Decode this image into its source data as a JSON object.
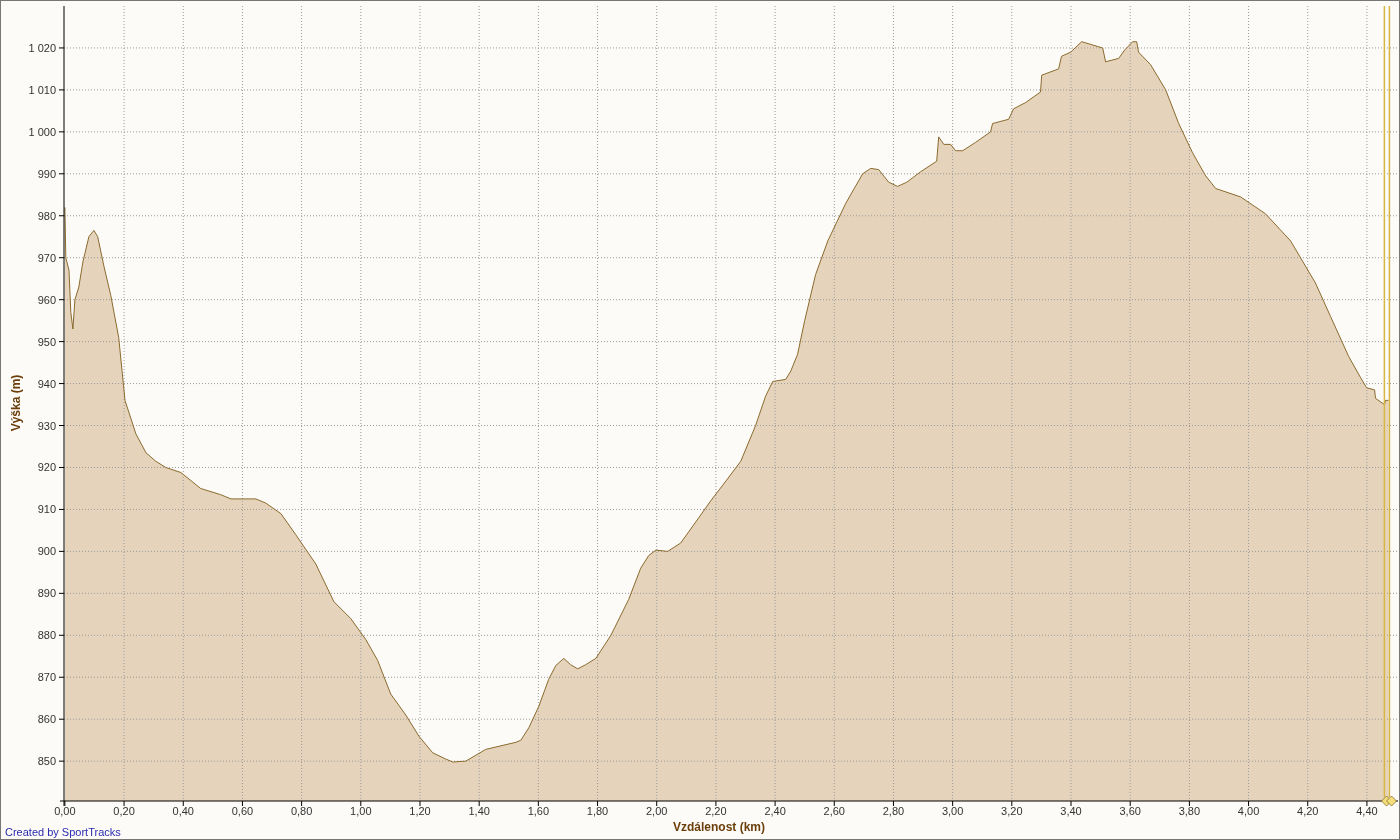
{
  "chart": {
    "chart_data": {
      "type": "area",
      "xlabel": "Vzdálenost (km)",
      "ylabel": "Výška (m)",
      "x": [
        0,
        0.003,
        0.014,
        0.02,
        0.027,
        0.034,
        0.047,
        0.061,
        0.081,
        0.098,
        0.111,
        0.132,
        0.155,
        0.182,
        0.203,
        0.24,
        0.274,
        0.307,
        0.341,
        0.392,
        0.459,
        0.527,
        0.561,
        0.645,
        0.679,
        0.73,
        0.78,
        0.848,
        0.909,
        0.966,
        1.017,
        1.057,
        1.101,
        1.152,
        1.196,
        1.243,
        1.287,
        1.311,
        1.355,
        1.422,
        1.524,
        1.541,
        1.568,
        1.601,
        1.635,
        1.659,
        1.686,
        1.709,
        1.733,
        1.76,
        1.794,
        1.845,
        1.905,
        1.946,
        1.973,
        1.997,
        2.037,
        2.081,
        2.142,
        2.182,
        2.236,
        2.284,
        2.334,
        2.368,
        2.392,
        2.436,
        2.453,
        2.476,
        2.5,
        2.537,
        2.578,
        2.639,
        2.696,
        2.723,
        2.75,
        2.784,
        2.814,
        2.845,
        2.892,
        2.946,
        2.953,
        2.97,
        2.993,
        3.01,
        3.034,
        3.078,
        3.128,
        3.135,
        3.189,
        3.206,
        3.247,
        3.297,
        3.301,
        3.358,
        3.368,
        3.399,
        3.436,
        3.507,
        3.517,
        3.561,
        3.581,
        3.608,
        3.622,
        3.628,
        3.669,
        3.72,
        3.764,
        3.811,
        3.855,
        3.889,
        3.973,
        4.057,
        4.142,
        4.226,
        4.277,
        4.338,
        4.378,
        4.399,
        4.426,
        4.429,
        4.459,
        4.463,
        4.473
      ],
      "series": [
        {
          "color": "#8b6a2e",
          "values": [
            982,
            970,
            967,
            957,
            953,
            960,
            963,
            969,
            975,
            976.5,
            975,
            968,
            961,
            951,
            936,
            928,
            923.5,
            921.5,
            920,
            918.8,
            915,
            913.5,
            912.5,
            912.5,
            911.5,
            909,
            904,
            897,
            888,
            884,
            879,
            874,
            866,
            861,
            856,
            852,
            850.5,
            849.8,
            850,
            852.8,
            854.5,
            855,
            858,
            863,
            869.5,
            872.8,
            874.5,
            873,
            872,
            873,
            874.5,
            880,
            888.5,
            896,
            899,
            900.3,
            900,
            902,
            908,
            912,
            917,
            921.5,
            930,
            937,
            940.5,
            941,
            943,
            947,
            955,
            966,
            974,
            983,
            990,
            991.3,
            991,
            988,
            987,
            988,
            990.5,
            993,
            998.8,
            997,
            997,
            995.5,
            995.5,
            997.5,
            1000,
            1002,
            1003,
            1005.5,
            1007,
            1009.5,
            1013.5,
            1015,
            1018,
            1019,
            1021.5,
            1020,
            1016.7,
            1017.5,
            1019.5,
            1021.5,
            1021.5,
            1019,
            1016,
            1010,
            1002,
            995,
            989.5,
            986.5,
            984.5,
            980.5,
            974,
            964,
            956,
            946.5,
            941.5,
            939,
            938.5,
            936.5,
            935,
            936,
            936
          ]
        }
      ],
      "grid": true,
      "ref_lines": [
        {
          "axis": "x",
          "value": 4.459,
          "color": "#d6b545"
        },
        {
          "axis": "x",
          "value": 4.476,
          "color": "#d6b545"
        }
      ],
      "xlim": [
        -0.003,
        4.505
      ],
      "ylim": [
        840.5,
        1030
      ],
      "xticks": [
        {
          "value": 0,
          "label": "0,00"
        },
        {
          "value": 0.2,
          "label": "0,20"
        },
        {
          "value": 0.4,
          "label": "0,40"
        },
        {
          "value": 0.6,
          "label": "0,60"
        },
        {
          "value": 0.8,
          "label": "0,80"
        },
        {
          "value": 1.0,
          "label": "1,00"
        },
        {
          "value": 1.2,
          "label": "1,20"
        },
        {
          "value": 1.4,
          "label": "1,40"
        },
        {
          "value": 1.6,
          "label": "1,60"
        },
        {
          "value": 1.8,
          "label": "1,80"
        },
        {
          "value": 2.0,
          "label": "2,00"
        },
        {
          "value": 2.2,
          "label": "2,20"
        },
        {
          "value": 2.4,
          "label": "2,40"
        },
        {
          "value": 2.6,
          "label": "2,60"
        },
        {
          "value": 2.8,
          "label": "2,80"
        },
        {
          "value": 3.0,
          "label": "3,00"
        },
        {
          "value": 3.2,
          "label": "3,20"
        },
        {
          "value": 3.4,
          "label": "3,40"
        },
        {
          "value": 3.6,
          "label": "3,60"
        },
        {
          "value": 3.8,
          "label": "3,80"
        },
        {
          "value": 4.0,
          "label": "4,00"
        },
        {
          "value": 4.2,
          "label": "4,20"
        },
        {
          "value": 4.4,
          "label": "4,40"
        }
      ],
      "yticks": [
        850,
        860,
        870,
        880,
        890,
        900,
        910,
        920,
        930,
        940,
        950,
        960,
        970,
        980,
        990,
        {
          "value": 1000,
          "label": "1 000"
        },
        {
          "value": 1010,
          "label": "1 010"
        },
        {
          "value": 1020,
          "label": "1 020"
        }
      ]
    }
  },
  "footer": "Created by SportTracks"
}
